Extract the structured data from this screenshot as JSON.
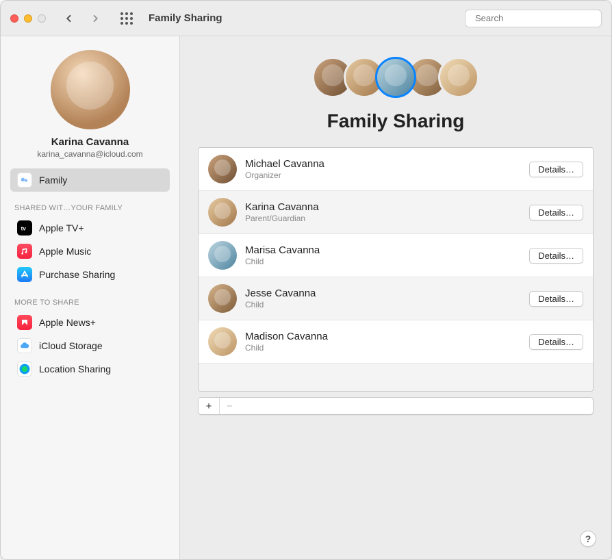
{
  "window": {
    "title": "Family Sharing"
  },
  "search": {
    "placeholder": "Search"
  },
  "profile": {
    "name": "Karina Cavanna",
    "email": "karina_cavanna@icloud.com"
  },
  "sidebar": {
    "family_label": "Family",
    "shared_header": "SHARED WIT…YOUR FAMILY",
    "more_header": "MORE TO SHARE",
    "items": {
      "tv": "Apple TV+",
      "music": "Apple Music",
      "purchase": "Purchase Sharing",
      "news": "Apple News+",
      "icloud": "iCloud Storage",
      "location": "Location Sharing"
    }
  },
  "hero": {
    "title": "Family Sharing"
  },
  "members": [
    {
      "name": "Michael Cavanna",
      "role": "Organizer",
      "button": "Details…"
    },
    {
      "name": "Karina Cavanna",
      "role": "Parent/Guardian",
      "button": "Details…"
    },
    {
      "name": "Marisa Cavanna",
      "role": "Child",
      "button": "Details…"
    },
    {
      "name": "Jesse Cavanna",
      "role": "Child",
      "button": "Details…"
    },
    {
      "name": "Madison Cavanna",
      "role": "Child",
      "button": "Details…"
    }
  ],
  "buttons": {
    "add": "+",
    "remove": "−",
    "help": "?"
  }
}
